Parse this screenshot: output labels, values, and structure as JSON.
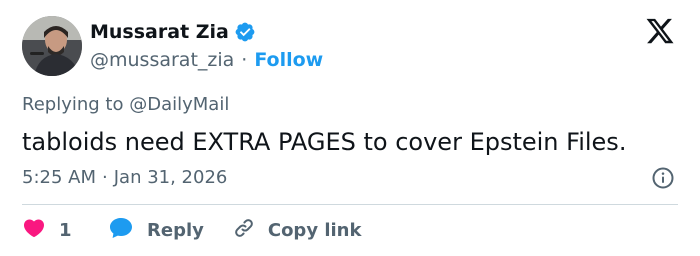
{
  "user": {
    "display_name": "Mussarat Zia",
    "handle": "@mussarat_zia",
    "separator": "·",
    "follow_label": "Follow",
    "verified": true
  },
  "reply_context": {
    "prefix": "Replying to",
    "mention": "@DailyMail"
  },
  "tweet": {
    "text": "tabloids need EXTRA PAGES to cover Epstein Files.",
    "time": "5:25 AM",
    "separator": "·",
    "date": "Jan 31, 2026"
  },
  "actions": {
    "like_count": "1",
    "reply_label": "Reply",
    "copy_link_label": "Copy link"
  },
  "icons": {
    "brand": "x-logo-icon",
    "verified": "verified-badge-icon",
    "info": "info-icon",
    "like": "heart-icon",
    "reply": "speech-bubble-icon",
    "copy_link": "link-icon"
  },
  "colors": {
    "accent": "#1d9bf0",
    "like": "#f91880",
    "text_primary": "#0f1419",
    "text_secondary": "#536471",
    "divider": "#cfd9de"
  }
}
